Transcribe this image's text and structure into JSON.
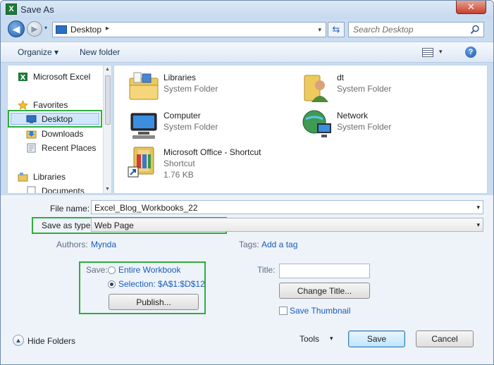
{
  "window": {
    "title": "Save As",
    "close_glyph": "✕"
  },
  "address": {
    "location": "Desktop",
    "separator": "▸",
    "dropdown": "▾"
  },
  "search": {
    "placeholder": "Search Desktop"
  },
  "nav_buttons": {
    "back": "◀",
    "forward": "▶",
    "history": "▾",
    "refresh": "⇆"
  },
  "toolbar": {
    "organize": "Organize ▾",
    "new_folder": "New folder",
    "views_dropdown": "▾",
    "help": "?"
  },
  "nav_pane": {
    "items": [
      {
        "label": "Microsoft Excel",
        "icon": "excel-icon"
      },
      {
        "label": "Favorites",
        "icon": "star-icon"
      },
      {
        "label": "Desktop",
        "icon": "desktop-icon",
        "selected": true
      },
      {
        "label": "Downloads",
        "icon": "downloads-icon"
      },
      {
        "label": "Recent Places",
        "icon": "recent-places-icon"
      },
      {
        "label": "Libraries",
        "icon": "libraries-icon"
      },
      {
        "label": "Documents",
        "icon": "documents-icon"
      }
    ]
  },
  "files": [
    {
      "name": "Libraries",
      "type": "System Folder",
      "icon": "libraries-folder-icon"
    },
    {
      "name": "dt",
      "type": "System Folder",
      "icon": "user-folder-icon"
    },
    {
      "name": "Computer",
      "type": "System Folder",
      "icon": "computer-icon"
    },
    {
      "name": "Network",
      "type": "System Folder",
      "icon": "network-icon"
    },
    {
      "name": "Microsoft Office - Shortcut",
      "type": "Shortcut",
      "size": "1.76 KB",
      "icon": "office-shortcut-icon"
    }
  ],
  "form": {
    "file_name_label": "File name:",
    "file_name_value": "Excel_Blog_Workbooks_22",
    "save_type_label": "Save as type:",
    "save_type_value": "Web Page",
    "authors_label": "Authors:",
    "authors_value": "Mynda",
    "tags_label": "Tags:",
    "tags_value": "Add a tag",
    "save_label": "Save:",
    "save_option_workbook": "Entire Workbook",
    "save_option_selection": "Selection: $A$1:$D$12",
    "publish_label": "Publish...",
    "title_label": "Title:",
    "title_value": "",
    "change_title_label": "Change Title...",
    "save_thumbnail_label": "Save Thumbnail",
    "dropdown_glyph": "▾"
  },
  "footer": {
    "hide_folders": "Hide Folders",
    "hide_glyph": "▲",
    "tools": "Tools",
    "tools_glyph": "▾",
    "save": "Save",
    "cancel": "Cancel"
  },
  "colors": {
    "highlight_green": "#2eae3d",
    "link_blue": "#1a5bbd",
    "selection_blue": "#d1e6fb"
  }
}
